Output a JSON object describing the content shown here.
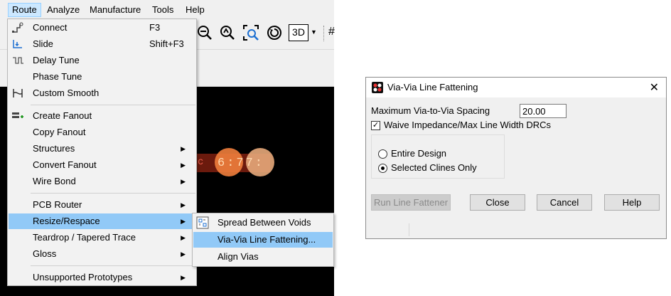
{
  "menubar": {
    "items": [
      {
        "label": "Route",
        "active": true
      },
      {
        "label": "Analyze"
      },
      {
        "label": "Manufacture"
      },
      {
        "label": "Tools"
      },
      {
        "label": "Help"
      }
    ]
  },
  "toolbar": {
    "zoom_3d_label": "3D"
  },
  "route_menu": {
    "items": [
      {
        "label": "Connect",
        "shortcut": "F3",
        "icon": "connect-icon"
      },
      {
        "label": "Slide",
        "shortcut": "Shift+F3",
        "icon": "slide-icon"
      },
      {
        "label": "Delay Tune",
        "icon": "delay-tune-icon"
      },
      {
        "label": "Phase Tune"
      },
      {
        "label": "Custom Smooth",
        "icon": "custom-smooth-icon"
      },
      {
        "label": "Create Fanout",
        "icon": "fanout-icon"
      },
      {
        "label": "Copy Fanout"
      },
      {
        "label": "Structures",
        "submenu": true
      },
      {
        "label": "Convert Fanout",
        "submenu": true
      },
      {
        "label": "Wire Bond",
        "submenu": true
      },
      {
        "label": "PCB Router",
        "submenu": true
      },
      {
        "label": "Resize/Respace",
        "submenu": true,
        "highlighted": true
      },
      {
        "label": "Teardrop / Tapered Trace",
        "submenu": true
      },
      {
        "label": "Gloss",
        "submenu": true
      },
      {
        "label": "Unsupported Prototypes",
        "submenu": true
      }
    ]
  },
  "resize_submenu": {
    "items": [
      {
        "label": "Spread Between Voids",
        "icon": "spread-voids-icon"
      },
      {
        "label": "Via-Via Line Fattening...",
        "highlighted": true
      },
      {
        "label": "Align Vias"
      }
    ]
  },
  "canvas": {
    "trace_text": "6:77:"
  },
  "dialog": {
    "title": "Via-Via Line Fattening",
    "spacing_label": "Maximum Via-to-Via Spacing",
    "spacing_value": "20.00",
    "waive_label": "Waive Impedance/Max Line Width DRCs",
    "waive_checked": true,
    "radio_entire": "Entire Design",
    "radio_selected": "Selected Clines Only",
    "selected_radio": "Selected Clines Only",
    "buttons": {
      "run": "Run Line Fattener",
      "close": "Close",
      "cancel": "Cancel",
      "help": "Help"
    }
  },
  "colors": {
    "menu_highlight": "#91c9f7",
    "menubar_active": "#cce8ff",
    "canvas_bg": "#000000",
    "via_orange": "#f08040"
  }
}
